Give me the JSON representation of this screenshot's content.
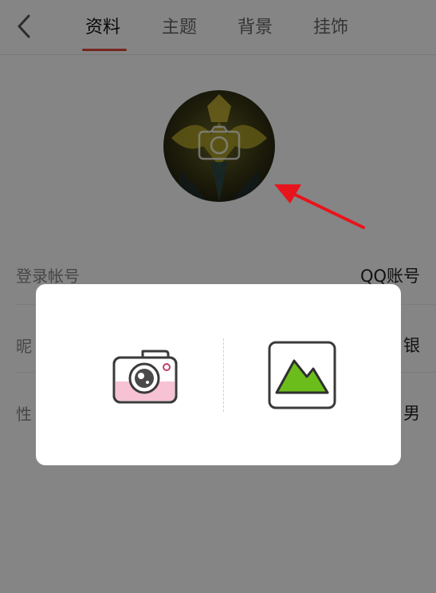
{
  "header": {
    "back_icon": "chevron-left-icon",
    "tabs": [
      {
        "label": "资料",
        "active": true
      },
      {
        "label": "主题",
        "active": false
      },
      {
        "label": "背景",
        "active": false
      },
      {
        "label": "挂饰",
        "active": false
      }
    ]
  },
  "avatar": {
    "overlay_icon": "camera-icon"
  },
  "annotation": {
    "color": "#e8141c"
  },
  "rows": {
    "account": {
      "label": "登录帐号",
      "value": "QQ账号"
    },
    "nickname": {
      "label": "昵",
      "value": "银"
    },
    "gender": {
      "label": "性",
      "value": "男"
    }
  },
  "dialog": {
    "camera_icon": "camera-icon",
    "album_icon": "picture-icon"
  },
  "colors": {
    "accent": "#e14a3a",
    "camera_pink": "#f7c2d3",
    "album_green": "#6bbd1c"
  }
}
